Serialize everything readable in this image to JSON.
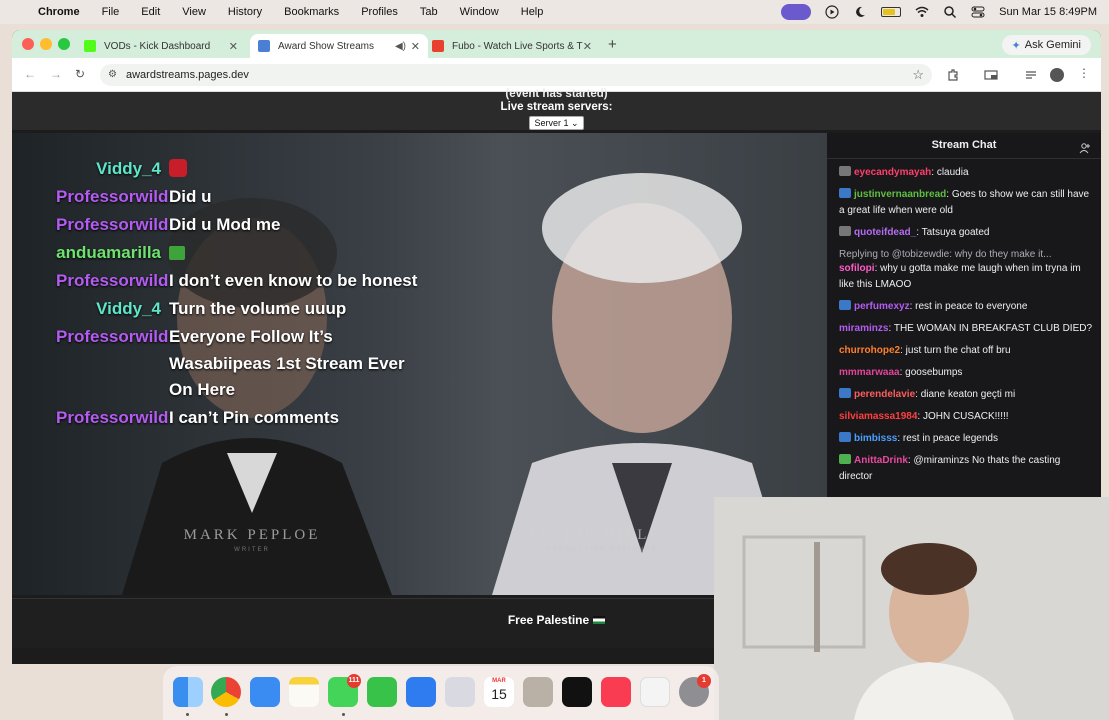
{
  "menubar": {
    "app": "Chrome",
    "items": [
      "File",
      "Edit",
      "View",
      "History",
      "Bookmarks",
      "Profiles",
      "Tab",
      "Window",
      "Help"
    ],
    "clock": "Sun Mar 15  8:49PM"
  },
  "tabs": [
    {
      "label": "VODs - Kick Dashboard",
      "favicon": "kick-icon",
      "color": "#53fc18"
    },
    {
      "label": "Award Show Streams",
      "favicon": "stream-icon",
      "color": "#4a7fd4"
    },
    {
      "label": "Fubo - Watch Live Sports & T",
      "favicon": "fubo-icon",
      "color": "#e8412e"
    }
  ],
  "gemini_label": "Ask Gemini",
  "address": "awardstreams.pages.dev",
  "page": {
    "event_status": "(event has started)",
    "servers_label": "Live stream servers:",
    "server_selected": "Server 1",
    "video_names": [
      {
        "name": "MARK PEPLOE",
        "role": "WRITER"
      },
      {
        "name": "LESLIE DILLEY",
        "role": "PRODUCTION DESIGNER"
      }
    ],
    "overlay_chat": [
      {
        "user": "Viddy_4",
        "color": "#5ee6c9",
        "msg": "",
        "emoji": "red"
      },
      {
        "user": "Professorwild",
        "color": "#b45cf2",
        "msg": "Did u"
      },
      {
        "user": "Professorwild",
        "color": "#b45cf2",
        "msg": "Did u Mod me"
      },
      {
        "user": "anduamarilla",
        "color": "#6ee26e",
        "msg": "",
        "emoji": "green"
      },
      {
        "user": "Professorwild",
        "color": "#b45cf2",
        "msg": "I don’t even know to be honest"
      },
      {
        "user": "Viddy_4",
        "color": "#5ee6c9",
        "msg": "Turn the volume uuup"
      },
      {
        "user": "Professorwild",
        "color": "#b45cf2",
        "msg": "Everyone Follow It’s Wasabiipeas 1st Stream Ever On Here"
      },
      {
        "user": "Professorwild",
        "color": "#b45cf2",
        "msg": "I can’t Pin comments"
      }
    ],
    "footer": "Free Palestine"
  },
  "stream_chat": {
    "title": "Stream Chat",
    "messages": [
      {
        "user": "eyecandymayah",
        "color": "#ff3f6c",
        "text": ": claudia",
        "badge": true,
        "badge_color": "#777"
      },
      {
        "user": "justinvernaanbread",
        "color": "#5fbf3f",
        "text": ": Goes to show we can still have a great life when were old",
        "badge": true,
        "badge_color": "#3c78c8"
      },
      {
        "user": "quoteifdead_",
        "color": "#b66cf2",
        "text": ": Tatsuya goated",
        "badge": true,
        "badge_color": "#777"
      },
      {
        "reply": "Replying to @tobizewdie: why do they make it...",
        "user": "sofilopi",
        "color": "#ff5cc8",
        "text": ": why u gotta make me laugh when im tryna im like this LMAOO"
      },
      {
        "user": "perfumexyz",
        "color": "#b45cf2",
        "text": ": rest in peace to everyone",
        "badge": true,
        "badge_color": "#3c78c8"
      },
      {
        "user": "miraminzs",
        "color": "#b45cf2",
        "text": ": THE WOMAN IN BREAKFAST CLUB DIED?"
      },
      {
        "user": "churrohope2",
        "color": "#ff7f2a",
        "text": ": just turn the chat off bru"
      },
      {
        "user": "mmmarwaaa",
        "color": "#e0459a",
        "text": ": goosebumps"
      },
      {
        "user": "perendelavie",
        "color": "#ff5c5c",
        "text": ": diane keaton geçti mi",
        "badge": true,
        "badge_color": "#3c78c8"
      },
      {
        "user": "silviamassa1984",
        "color": "#ff3f3f",
        "text": ": JOHN CUSACK!!!!!"
      },
      {
        "user": "bimbisss",
        "color": "#4a9fff",
        "text": ": rest in peace legends",
        "badge": true,
        "badge_color": "#3c78c8"
      },
      {
        "user": "AnittaDrink",
        "color": "#e84aa0",
        "text": ": @miraminzs No thats the casting director",
        "badge": true,
        "badge_color": "#4fb04f"
      }
    ]
  },
  "dock": {
    "messages_badge": "111",
    "calendar_month": "MAR",
    "calendar_day": "15",
    "settings_badge": "1"
  }
}
